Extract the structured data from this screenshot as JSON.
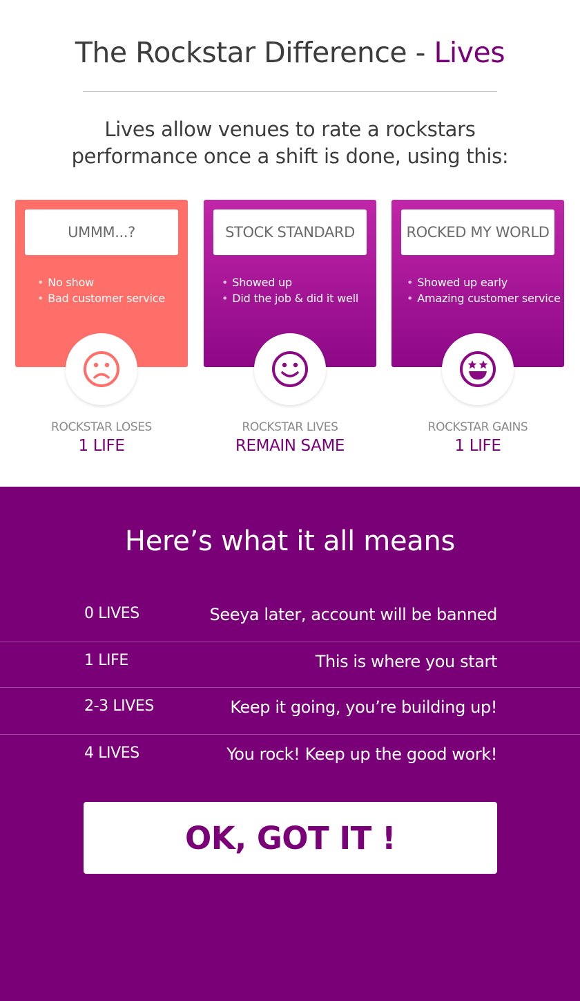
{
  "header": {
    "title_prefix": "The Rockstar Difference - ",
    "title_accent": "Lives",
    "intro_line1": "Lives allow venues to rate a rockstars",
    "intro_line2": "performance once a shift is done, using this:"
  },
  "cards": [
    {
      "heading": "UMMM...?",
      "bullets": [
        "No show",
        "Bad customer service"
      ],
      "face_icon": "sad-face-icon",
      "outcome_label": "ROCKSTAR LOSES",
      "outcome_value": "1 LIFE"
    },
    {
      "heading": "STOCK STANDARD",
      "bullets": [
        "Showed up",
        "Did the job & did it well"
      ],
      "face_icon": "smile-face-icon",
      "outcome_label": "ROCKSTAR LIVES",
      "outcome_value": "REMAIN SAME"
    },
    {
      "heading": "ROCKED MY WORLD",
      "bullets": [
        "Showed up early",
        "Amazing customer service"
      ],
      "face_icon": "star-eyes-face-icon",
      "outcome_label": "ROCKSTAR GAINS",
      "outcome_value": "1 LIFE"
    }
  ],
  "means": {
    "title": "Here’s what it all means",
    "rows": [
      {
        "lives": "0 LIVES",
        "description": "Seeya later, account will be banned"
      },
      {
        "lives": "1 LIFE",
        "description": "This is where you start"
      },
      {
        "lives": "2-3 LIVES",
        "description": "Keep it going, you’re building up!"
      },
      {
        "lives": "4 LIVES",
        "description": "You rock! Keep up the good work!"
      }
    ]
  },
  "ok_button_label": "OK, GOT IT !",
  "colors": {
    "brand_purple": "#7a0077",
    "card_red": "#ff6f69",
    "card_purple_top": "#c026a8",
    "card_purple_bottom": "#8d0887"
  }
}
